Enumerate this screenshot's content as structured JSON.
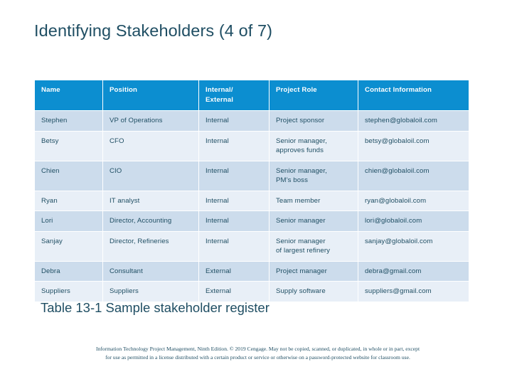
{
  "slide": {
    "title": "Identifying Stakeholders (4 of 7)",
    "caption": "Table 13-1 Sample stakeholder register",
    "colors": {
      "header_blue": "#0c8ed0",
      "row_shaded": "#ccdcec",
      "row_light": "#e8eff7",
      "text_dark_blue": "#1f4e63",
      "background": "#ffffff"
    }
  },
  "table": {
    "headers": [
      "Name",
      "Position",
      "Internal/ External",
      "Project Role",
      "Contact Information"
    ],
    "header_lines": {
      "col3_line1": "Internal/",
      "col3_line2": "External"
    },
    "rows": [
      {
        "name": "Stephen",
        "position": "VP of Operations",
        "internal_external": "Internal",
        "project_role": "Project sponsor",
        "project_role_line1": "Project sponsor",
        "project_role_line2": "",
        "contact": "stephen@globaloil.com"
      },
      {
        "name": "Betsy",
        "position": "CFO",
        "internal_external": "Internal",
        "project_role": "Senior manager, approves funds",
        "project_role_line1": "Senior manager,",
        "project_role_line2": "approves funds",
        "contact": "betsy@globaloil.com"
      },
      {
        "name": "Chien",
        "position": "CIO",
        "internal_external": "Internal",
        "project_role": "Senior manager, PM’s boss",
        "project_role_line1": "Senior manager,",
        "project_role_line2": "PM’s boss",
        "contact": "chien@globaloil.com"
      },
      {
        "name": "Ryan",
        "position": "IT analyst",
        "internal_external": "Internal",
        "project_role": "Team member",
        "project_role_line1": "Team member",
        "project_role_line2": "",
        "contact": "ryan@globaloil.com"
      },
      {
        "name": "Lori",
        "position": "Director, Accounting",
        "internal_external": "Internal",
        "project_role": "Senior manager",
        "project_role_line1": "Senior manager",
        "project_role_line2": "",
        "contact": "lori@globaloil.com"
      },
      {
        "name": "Sanjay",
        "position": "Director, Refineries",
        "internal_external": "Internal",
        "project_role": "Senior manager of largest refinery",
        "project_role_line1": "Senior manager",
        "project_role_line2": "of largest refinery",
        "contact": "sanjay@globaloil.com"
      },
      {
        "name": "Debra",
        "position": "Consultant",
        "internal_external": "External",
        "project_role": "Project manager",
        "project_role_line1": "Project manager",
        "project_role_line2": "",
        "contact": "debra@gmail.com"
      },
      {
        "name": "Suppliers",
        "position": "Suppliers",
        "internal_external": "External",
        "project_role": "Supply software",
        "project_role_line1": "Supply software",
        "project_role_line2": "",
        "contact": "suppliers@gmail.com"
      }
    ]
  },
  "footer": {
    "line1": "Information Technology Project Management, Ninth Edition. © 2019 Cengage. May not be copied, scanned, or duplicated, in whole or in part, except",
    "line2": "for use as permitted in a license distributed with a certain product or service or otherwise on a password-protected website for classroom use."
  }
}
